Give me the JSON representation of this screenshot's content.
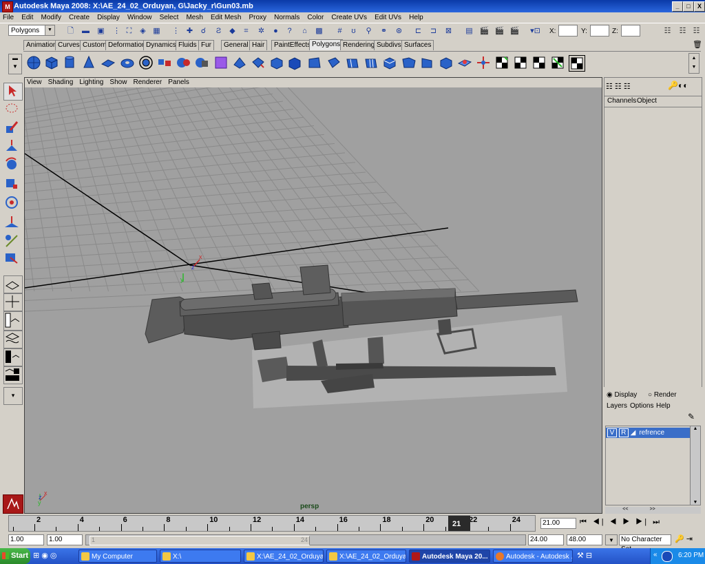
{
  "window": {
    "title": "Autodesk Maya 2008: X:\\AE_24_02_Orduyan, G\\Jacky_r\\Gun03.mb",
    "minimize": "_",
    "maximize": "□",
    "close": "X"
  },
  "menubar": [
    "File",
    "Edit",
    "Modify",
    "Create",
    "Display",
    "Window",
    "Select",
    "Mesh",
    "Edit Mesh",
    "Proxy",
    "Normals",
    "Color",
    "Create UVs",
    "Edit UVs",
    "Help"
  ],
  "statusline": {
    "mode": "Polygons",
    "x_label": "X:",
    "y_label": "Y:",
    "z_label": "Z:"
  },
  "shelf_tabs": [
    "Animation",
    "Curves",
    "Custom",
    "Deformation",
    "Dynamics",
    "Fluids",
    "Fur",
    "General",
    "Hair",
    "PaintEffects",
    "Polygons",
    "Rendering",
    "Subdivs",
    "Surfaces"
  ],
  "shelf_active": "Polygons",
  "viewport": {
    "menu": [
      "View",
      "Shading",
      "Lighting",
      "Show",
      "Renderer",
      "Panels"
    ],
    "camera_label": "persp",
    "axis_x": "x",
    "axis_y": "y",
    "axis_z": "z"
  },
  "channel_box": {
    "tabs": [
      "Channels",
      "Object"
    ]
  },
  "layer_editor": {
    "display": "Display",
    "render": "Render",
    "menu": [
      "Layers",
      "Options",
      "Help"
    ],
    "layer": {
      "v": "V",
      "r": "R",
      "name": "refrence"
    }
  },
  "time_slider": {
    "ticks": [
      "2",
      "4",
      "6",
      "8",
      "10",
      "12",
      "14",
      "16",
      "18",
      "20",
      "22",
      "24"
    ],
    "current_frame": "21",
    "current_time_field": "21.00"
  },
  "range_slider": {
    "start_time": "1.00",
    "playback_start": "1.00",
    "range_marker_start": "1",
    "range_marker_end": "24",
    "playback_end": "24.00",
    "end_time": "48.00",
    "character_set": "No Character Set"
  },
  "taskbar": {
    "start": "Start",
    "items": [
      {
        "label": "My Computer",
        "active": false
      },
      {
        "label": "X:\\",
        "active": false
      },
      {
        "label": "X:\\AE_24_02_Orduya...",
        "active": false
      },
      {
        "label": "X:\\AE_24_02_Orduya...",
        "active": false
      },
      {
        "label": "Autodesk Maya 20...",
        "active": true
      },
      {
        "label": "Autodesk - Autodesk ...",
        "active": false
      }
    ],
    "clock": "6:20 PM"
  },
  "colors": {
    "titlebar": "#0a3aa8",
    "viewport_bg": "#a0a0a0",
    "shelf_icon": "#2860c8",
    "layer_selected": "#3a6ec8",
    "taskbar": "#2a5ad6"
  }
}
